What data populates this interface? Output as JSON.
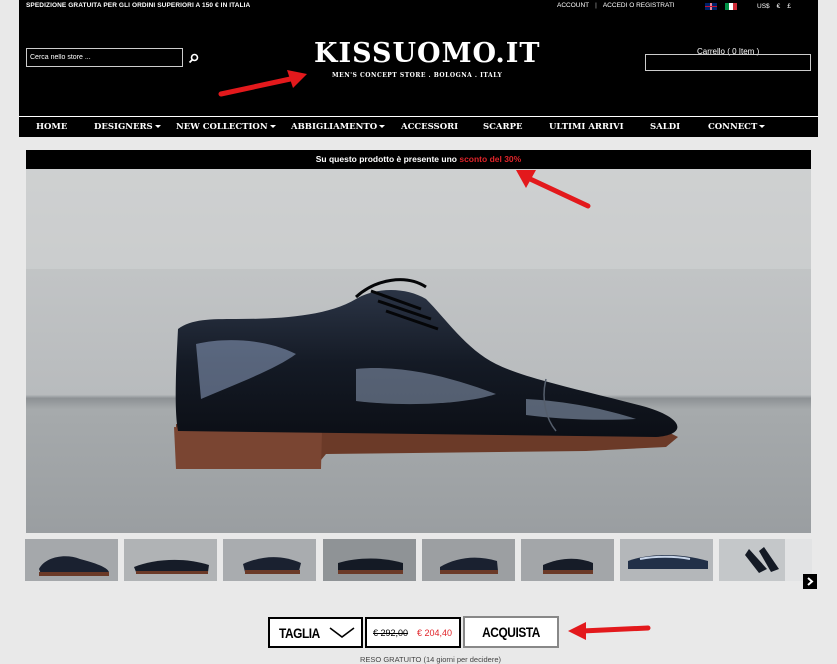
{
  "topbar": {
    "shipping_notice": "SPEDIZIONE GRATUITA PER GLI ORDINI SUPERIORI A 150 € IN ITALIA",
    "account": "ACCOUNT",
    "login_register": "ACCEDI O REGISTRATI",
    "currencies": [
      "US$",
      "€",
      "£"
    ]
  },
  "search": {
    "placeholder": "Cerca nello store ..."
  },
  "brand": {
    "logo": "KISSUOMO.IT",
    "tagline": "MEN'S CONCEPT STORE . BOLOGNA . ITALY"
  },
  "cart": {
    "label": "Carrello ( 0 Item )"
  },
  "nav": {
    "items": [
      {
        "label": "HOME"
      },
      {
        "label": "DESIGNERS"
      },
      {
        "label": "NEW COLLECTION"
      },
      {
        "label": "ABBIGLIAMENTO"
      },
      {
        "label": "ACCESSORI"
      },
      {
        "label": "SCARPE"
      },
      {
        "label": "ULTIMI ARRIVI"
      },
      {
        "label": "SALDI"
      },
      {
        "label": "CONNECT"
      }
    ]
  },
  "promo": {
    "text": "Su questo prodotto è presente uno",
    "highlight": "sconto del 30%"
  },
  "product": {
    "size_label": "TAGLIA",
    "price_old": "€ 292,00",
    "price_new": "€ 204,40",
    "buy_label": "ACQUISTA",
    "returns_note": "RESO GRATUITO (14 giorni per decidere)"
  },
  "colors": {
    "accent_red": "#e0242a",
    "header_bg": "#000000"
  }
}
